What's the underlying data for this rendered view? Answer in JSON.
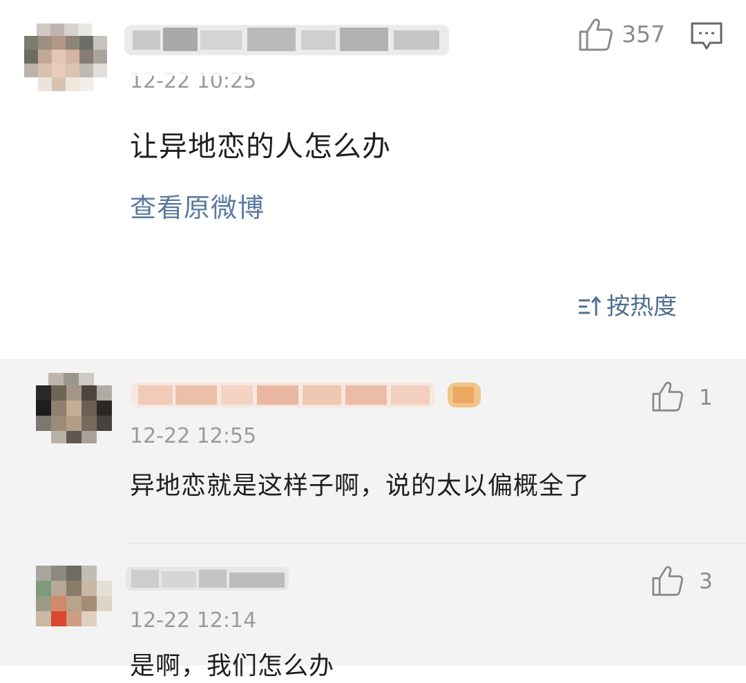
{
  "main_comment": {
    "likes": "357",
    "timestamp": "12-22 10:25",
    "content": "让异地恋的人怎么办",
    "view_original": "查看原微博"
  },
  "sort": {
    "icon": "sort-icon",
    "label": "按热度"
  },
  "replies": [
    {
      "timestamp": "12-22 12:55",
      "content": "异地恋就是这样子啊，说的太以偏概全了",
      "likes": "1"
    },
    {
      "timestamp": "12-22 12:14",
      "content": "是啊，我们怎么办",
      "likes": "3"
    }
  ],
  "colors": {
    "link": "#5a7a9c",
    "sort": "#4f6f8f",
    "muted": "#9a9a9a",
    "reply_bg": "#f3f3f3"
  }
}
